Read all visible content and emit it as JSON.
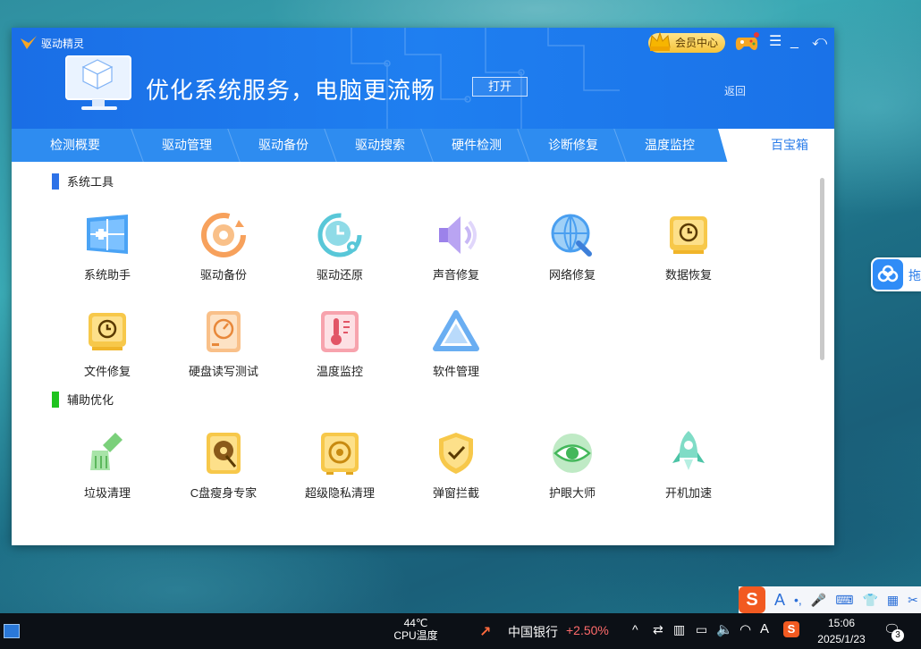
{
  "app": {
    "brand": "驱动精灵",
    "hero_title": "优化系统服务，电脑更流畅",
    "open_button": "打开",
    "back_link": "返回",
    "vip_label": "会员中心"
  },
  "tabs": [
    {
      "label": "检测概要"
    },
    {
      "label": "驱动管理"
    },
    {
      "label": "驱动备份"
    },
    {
      "label": "驱动搜索"
    },
    {
      "label": "硬件检测"
    },
    {
      "label": "诊断修复"
    },
    {
      "label": "温度监控"
    },
    {
      "label": "百宝箱",
      "active": true
    }
  ],
  "sections": [
    {
      "title": "系统工具",
      "bar_color": "#2d72e8",
      "tools": [
        {
          "label": "系统助手",
          "icon": "windows-icon"
        },
        {
          "label": "驱动备份",
          "icon": "driver-backup-icon"
        },
        {
          "label": "驱动还原",
          "icon": "driver-restore-icon"
        },
        {
          "label": "声音修复",
          "icon": "sound-repair-icon"
        },
        {
          "label": "网络修复",
          "icon": "network-repair-icon"
        },
        {
          "label": "数据恢复",
          "icon": "data-recovery-icon"
        },
        {
          "label": "文件修复",
          "icon": "file-repair-icon"
        },
        {
          "label": "硬盘读写测试",
          "icon": "disk-test-icon"
        },
        {
          "label": "温度监控",
          "icon": "thermometer-icon"
        },
        {
          "label": "软件管理",
          "icon": "software-manager-icon"
        }
      ]
    },
    {
      "title": "辅助优化",
      "bar_color": "#1ec31e",
      "tools": [
        {
          "label": "垃圾清理",
          "icon": "broom-icon"
        },
        {
          "label": "C盘瘦身专家",
          "icon": "c-drive-slim-icon"
        },
        {
          "label": "超级隐私清理",
          "icon": "privacy-safe-icon"
        },
        {
          "label": "弹窗拦截",
          "icon": "popup-shield-icon"
        },
        {
          "label": "护眼大师",
          "icon": "eye-care-icon"
        },
        {
          "label": "开机加速",
          "icon": "rocket-icon"
        }
      ]
    }
  ],
  "side_widget": {
    "label": "拖"
  },
  "ime": {
    "logo": "S",
    "mode": "A"
  },
  "taskbar": {
    "cpu_temp": "44℃",
    "cpu_label": "CPU温度",
    "stock_name": "中国银行",
    "stock_change": "+2.50%",
    "stock_color": "#ff4d4d",
    "time": "15:06",
    "date": "2025/1/23",
    "ime_indicator": "A",
    "notification_count": "3"
  }
}
